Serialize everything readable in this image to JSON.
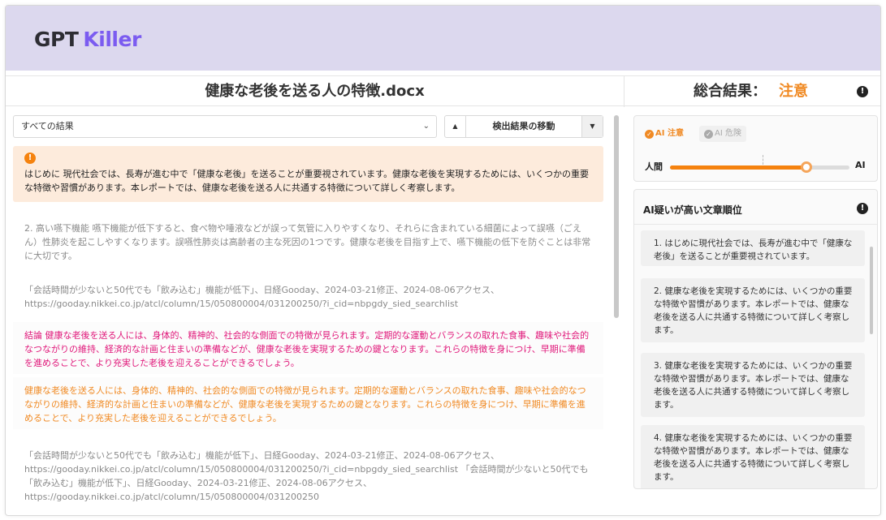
{
  "app": {
    "logo_part1": "GPT",
    "logo_part2": "Killer",
    "brand_color": "#7b5cf0",
    "header_bg": "#dcd8ee"
  },
  "document": {
    "title": "健康な老後を送る人の特徴.docx"
  },
  "summary": {
    "label": "総合結果：",
    "value": "注意",
    "value_color": "#f08a24",
    "info_icon": "info-icon"
  },
  "toolbar": {
    "filter_value": "すべての結果",
    "nav_label": "検出結果の移動"
  },
  "paragraphs": [
    {
      "text": "はじめに 現代社会では、長寿が進む中で「健康な老後」を送ることが重要視されています。健康な老後を実現するためには、いくつかの重要な特徴や習慣があります。本レポートでは、健康な老後を送る人に共通する特徴について詳しく考察します。",
      "status": "warning",
      "color": "#222222"
    },
    {
      "text": "2. 高い嚥下機能 嚥下機能が低下すると、食べ物や唾液などが誤って気管に入りやすくなり、それらに含まれている細菌によって誤嚥（ごえん）性肺炎を起こしやすくなります。誤嚥性肺炎は高齢者の主な死因の1つです。健康な老後を目指す上で、嚥下機能の低下を防ぐことは非常に大切です。",
      "status": "human",
      "color": "#8a8a8a"
    },
    {
      "text": "「会話時間が少ないと50代でも「飲み込む」機能が低下」、日経Gooday、2024-03-21修正、2024-08-06アクセス、https://gooday.nikkei.co.jp/atcl/column/15/050800004/031200250/?i_cid=nbpgdy_sied_searchlist",
      "status": "human",
      "color": "#8a8a8a"
    },
    {
      "text": "結論 健康な老後を送る人には、身体的、精神的、社会的な側面での特徴が見られます。定期的な運動とバランスの取れた食事、趣味や社会的なつながりの維持、経済的な計画と住まいの準備などが、健康な老後を実現するための鍵となります。これらの特徴を身につけ、早期に準備を進めることで、より充実した老後を迎えることができるでしょう。",
      "status": "danger",
      "color": "#e0187a"
    },
    {
      "text": "健康な老後を送る人には、身体的、精神的、社会的な側面での特徴が見られます。定期的な運動とバランスの取れた食事、趣味や社会的なつながりの維持、経済的な計画と住まいの準備などが、健康な老後を実現するための鍵となります。これらの特徴を身につけ、早期に準備を進めることで、より充実した老後を迎えることができるでしょう。",
      "status": "caution",
      "color": "#f08a24"
    },
    {
      "text": "「会話時間が少ないと50代でも「飲み込む」機能が低下」、日経Gooday、2024-03-21修正、2024-08-06アクセス、https://gooday.nikkei.co.jp/atcl/column/15/050800004/031200250/?i_cid=nbpgdy_sied_searchlist 「会話時間が少ないと50代でも「飲み込む」機能が低下」、日経Gooday、2024-03-21修正、2024-08-06アクセス、https://gooday.nikkei.co.jp/atcl/column/15/050800004/031200250",
      "status": "human",
      "color": "#8a8a8a"
    }
  ],
  "gauge": {
    "legend_caution": "AI 注意",
    "legend_danger": "AI 危険",
    "label_left": "人間",
    "label_right": "AI",
    "value_fraction": 0.76,
    "threshold_fraction": 0.52,
    "fill_color": "#f5820e"
  },
  "ranking": {
    "title": "AI疑いが高い文章順位",
    "items": [
      "1. はじめに現代社会では、長寿が進む中で「健康な老後」を送ることが重要視されています。",
      "2. 健康な老後を実現するためには、いくつかの重要な特徴や習慣があります。本レポートでは、健康な老後を送る人に共通する特徴について詳しく考察します。",
      "3. 健康な老後を実現するためには、いくつかの重要な特徴や習慣があります。本レポートでは、健康な老後を送る人に共通する特徴について詳しく考察します。",
      "4. 健康な老後を実現するためには、いくつかの重要な特徴や習慣があります。本レポートでは、健康な老後を送る人に共通する特徴について詳しく考察します。"
    ]
  }
}
